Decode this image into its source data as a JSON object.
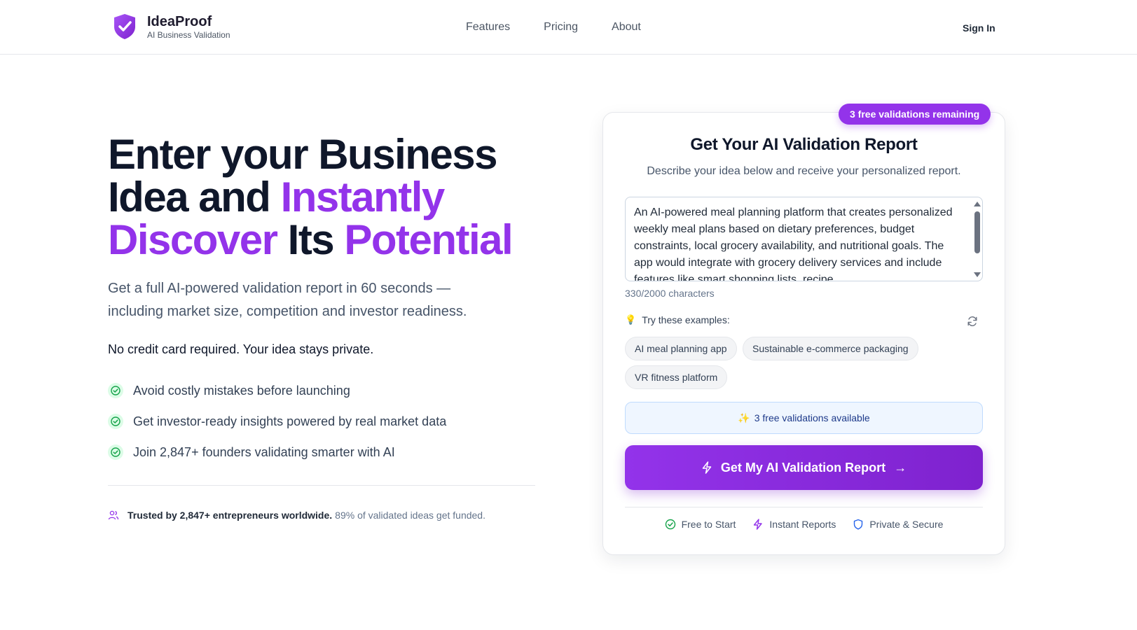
{
  "header": {
    "brand_name": "IdeaProof",
    "brand_tagline": "AI Business Validation",
    "nav": [
      "Features",
      "Pricing",
      "About"
    ],
    "sign_in": "Sign In"
  },
  "hero": {
    "title_line1": "Enter your Business",
    "title_line2_a": "Idea and ",
    "title_line2_b": "Instantly",
    "title_line3_a": "Discover",
    "title_line3_b": " Its ",
    "title_line3_c": "Potential",
    "subtitle": "Get a full AI-powered validation report in 60 seconds — including market size, competition and investor readiness.",
    "note": "No credit card required. Your idea stays private.",
    "bullets": [
      "Avoid costly mistakes before launching",
      "Get investor-ready insights powered by real market data",
      "Join 2,847+ founders validating smarter with AI"
    ],
    "trusted_bold": "Trusted by 2,847+ entrepreneurs worldwide.",
    "trusted_rest": "89% of validated ideas get funded."
  },
  "card": {
    "badge": "3 free validations remaining",
    "title": "Get Your AI Validation Report",
    "subtitle": "Describe your idea below and receive your personalized report.",
    "idea_value": "An AI-powered meal planning platform that creates personalized weekly meal plans based on dietary preferences, budget constraints, local grocery availability, and nutritional goals. The app would integrate with grocery delivery services and include features like smart shopping lists, recipe",
    "char_count": "330/2000 characters",
    "examples_label": "Try these examples:",
    "examples": [
      "AI meal planning app",
      "Sustainable e-commerce packaging",
      "VR fitness platform"
    ],
    "free_notice": "3 free validations available",
    "cta_label": "Get My AI Validation Report",
    "cta_arrow": "→",
    "features": [
      "Free to Start",
      "Instant Reports",
      "Private & Secure"
    ]
  },
  "colors": {
    "accent": "#9333ea",
    "accent_dark": "#7e22ce",
    "check_green": "#16a34a",
    "info_blue": "#1e3a8a"
  }
}
